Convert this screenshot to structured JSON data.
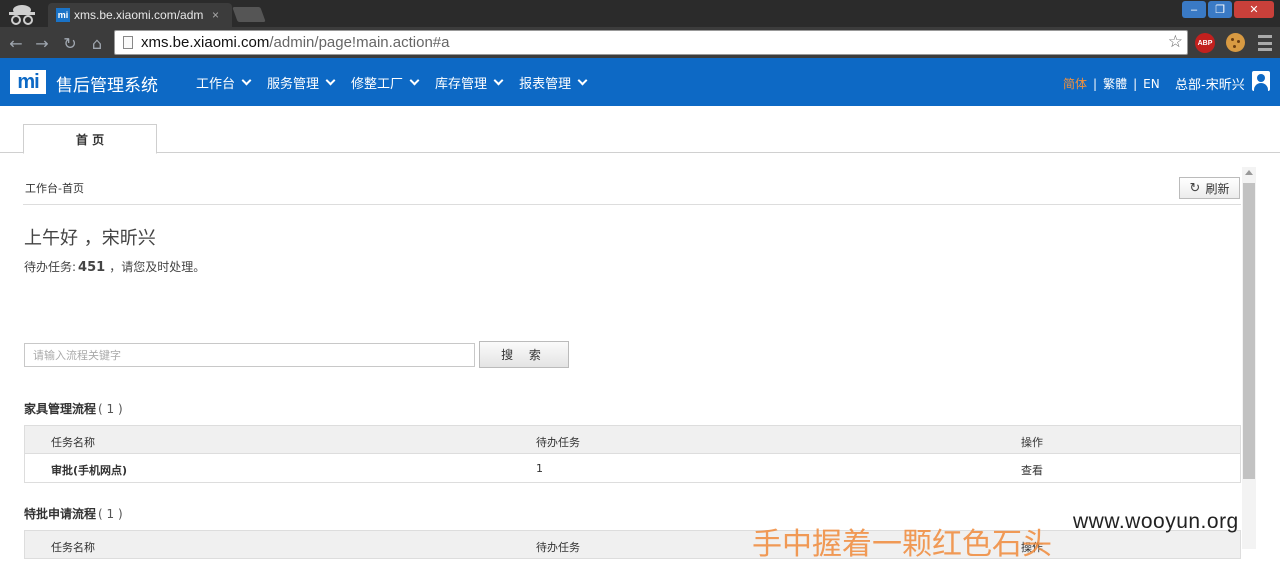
{
  "browser": {
    "tab_title": "xms.be.xiaomi.com/admin",
    "tab_favicon": "mi",
    "url_host": "xms.be.xiaomi.com",
    "url_path": "/admin/page!main.action#a",
    "ext_abp": "ABP"
  },
  "header": {
    "logo": "mi",
    "title": "售后管理系统",
    "nav": [
      "工作台",
      "服务管理",
      "修整工厂",
      "库存管理",
      "报表管理"
    ],
    "lang_simplified": "简体",
    "lang_sep": "|",
    "lang_traditional": "繁體",
    "lang_en": "EN",
    "user": "总部-宋昕兴",
    "brand_color": "#0d69c5",
    "accent_color": "#f5913a"
  },
  "tabs": {
    "home": "首 页"
  },
  "content": {
    "breadcrumb": "工作台-首页",
    "refresh_label": "刷新",
    "greeting": "上午好 ，宋昕兴",
    "pending_prefix": "待办任务:",
    "pending_count": "451",
    "pending_suffix": "，请您及时处理。",
    "search_placeholder": "请输入流程关键字",
    "search_button": "搜 索",
    "sections": [
      {
        "title": "家具管理流程",
        "count": "( 1 )",
        "headers": [
          "任务名称",
          "待办任务",
          "操作"
        ],
        "rows": [
          [
            "审批(手机网点)",
            "1",
            "查看"
          ]
        ]
      },
      {
        "title": "特批申请流程",
        "count": "( 1 )",
        "headers": [
          "任务名称",
          "待办任务",
          "操作"
        ],
        "rows": []
      }
    ]
  },
  "watermark": {
    "text_cn": "手中握着一颗红色石头",
    "url": "www.wooyun.org"
  }
}
